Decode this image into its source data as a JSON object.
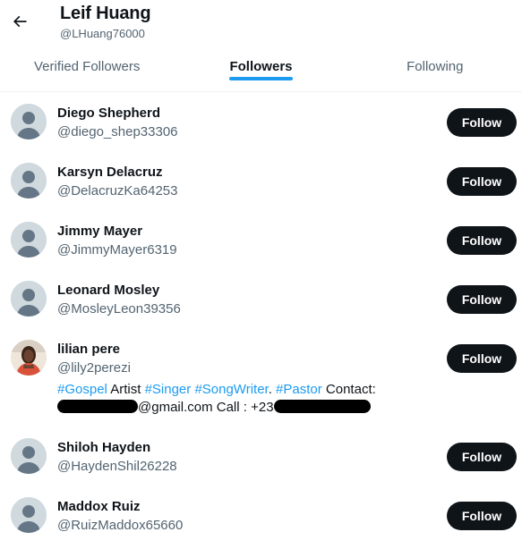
{
  "header": {
    "name": "Leif Huang",
    "handle": "@LHuang76000"
  },
  "tabs": [
    {
      "label": "Verified Followers",
      "active": false
    },
    {
      "label": "Followers",
      "active": true
    },
    {
      "label": "Following",
      "active": false
    }
  ],
  "colors": {
    "accent": "#1d9bf0",
    "button_bg": "#0f1419",
    "secondary_text": "#536471"
  },
  "followers": [
    {
      "name": "Diego Shepherd",
      "handle": "@diego_shep33306",
      "button": "Follow",
      "avatar": "default-avatar-icon"
    },
    {
      "name": "Karsyn Delacruz",
      "handle": "@DelacruzKa64253",
      "button": "Follow",
      "avatar": "default-avatar-icon"
    },
    {
      "name": "Jimmy Mayer",
      "handle": "@JimmyMayer6319",
      "button": "Follow",
      "avatar": "default-avatar-icon"
    },
    {
      "name": "Leonard Mosley",
      "handle": "@MosleyLeon39356",
      "button": "Follow",
      "avatar": "default-avatar-icon"
    },
    {
      "name": "lilian pere",
      "handle": "@lily2perezi",
      "button": "Follow",
      "avatar": "photo-avatar",
      "bio": {
        "tag1": "#Gospel",
        "text1": " Artist ",
        "tag2": "#Singer",
        "text2": " ",
        "tag3": "#SongWriter",
        "text3": ". ",
        "tag4": "#Pastor",
        "text4": " Contact:",
        "email_suffix": "@gmail.com Call : +23"
      }
    },
    {
      "name": "Shiloh Hayden",
      "handle": "@HaydenShil26228",
      "button": "Follow",
      "avatar": "default-avatar-icon"
    },
    {
      "name": "Maddox Ruiz",
      "handle": "@RuizMaddox65660",
      "button": "Follow",
      "avatar": "default-avatar-icon"
    }
  ]
}
